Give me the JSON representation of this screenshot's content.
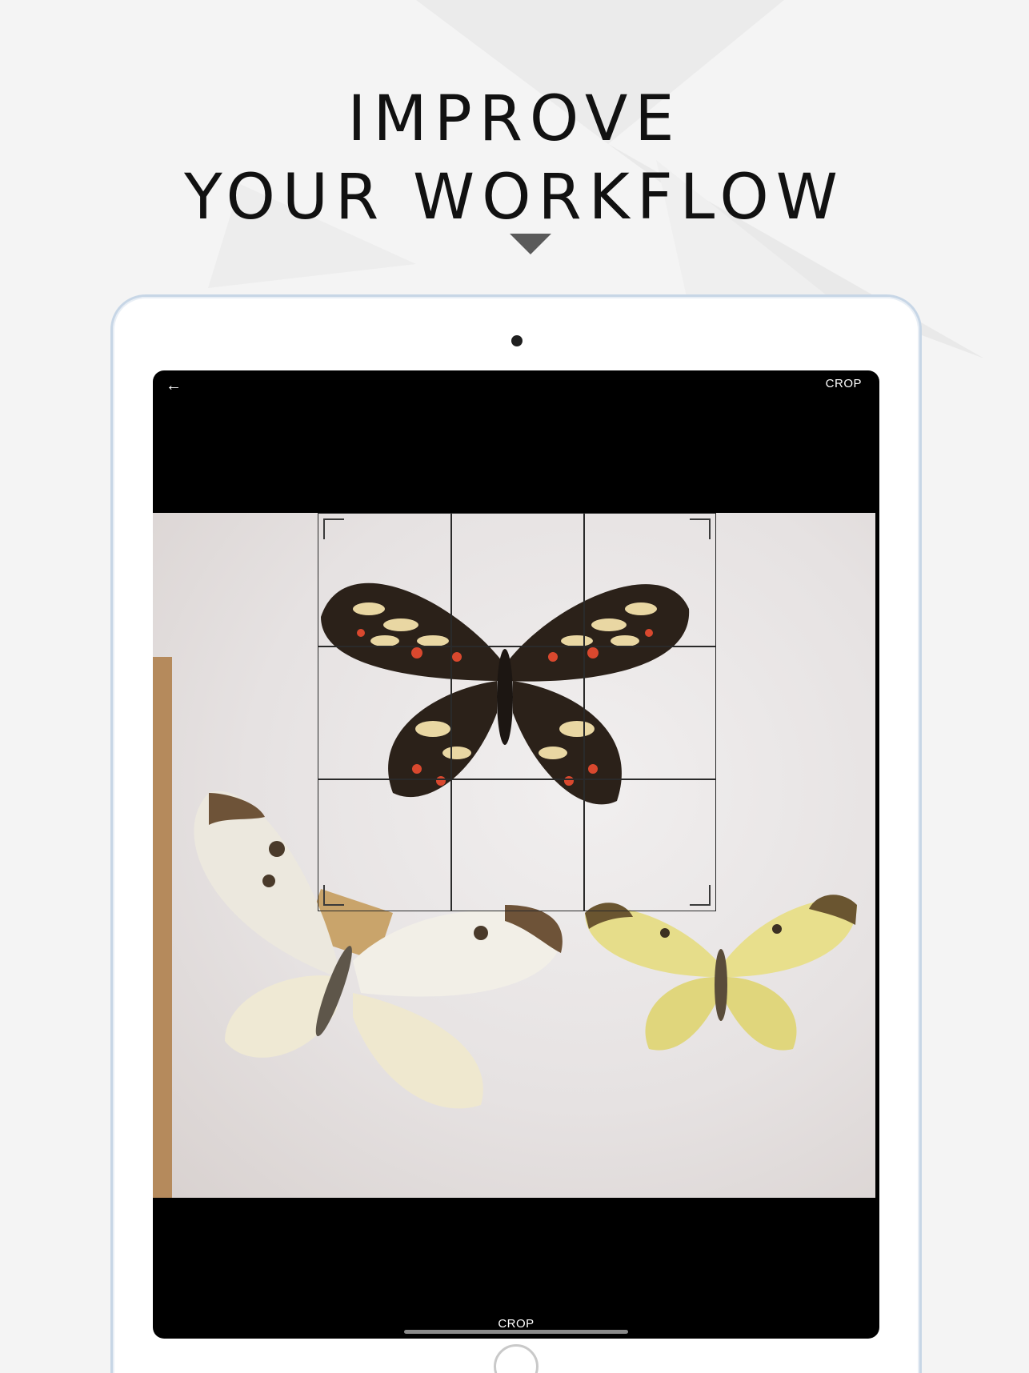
{
  "headline": {
    "line1": "IMPROVE",
    "line2": "YOUR WORKFLOW"
  },
  "icons": {
    "pointer": "triangle-down-icon",
    "back": "arrow-left-icon"
  },
  "screen": {
    "back_glyph": "←",
    "top_action_label": "CROP",
    "bottom_action_label": "CROP"
  },
  "colors": {
    "background": "#f4f4f4",
    "headline": "#111111",
    "tablet_frame": "#c7d6e6",
    "screen_bg": "#000000",
    "pointer": "#5a5a5a"
  }
}
